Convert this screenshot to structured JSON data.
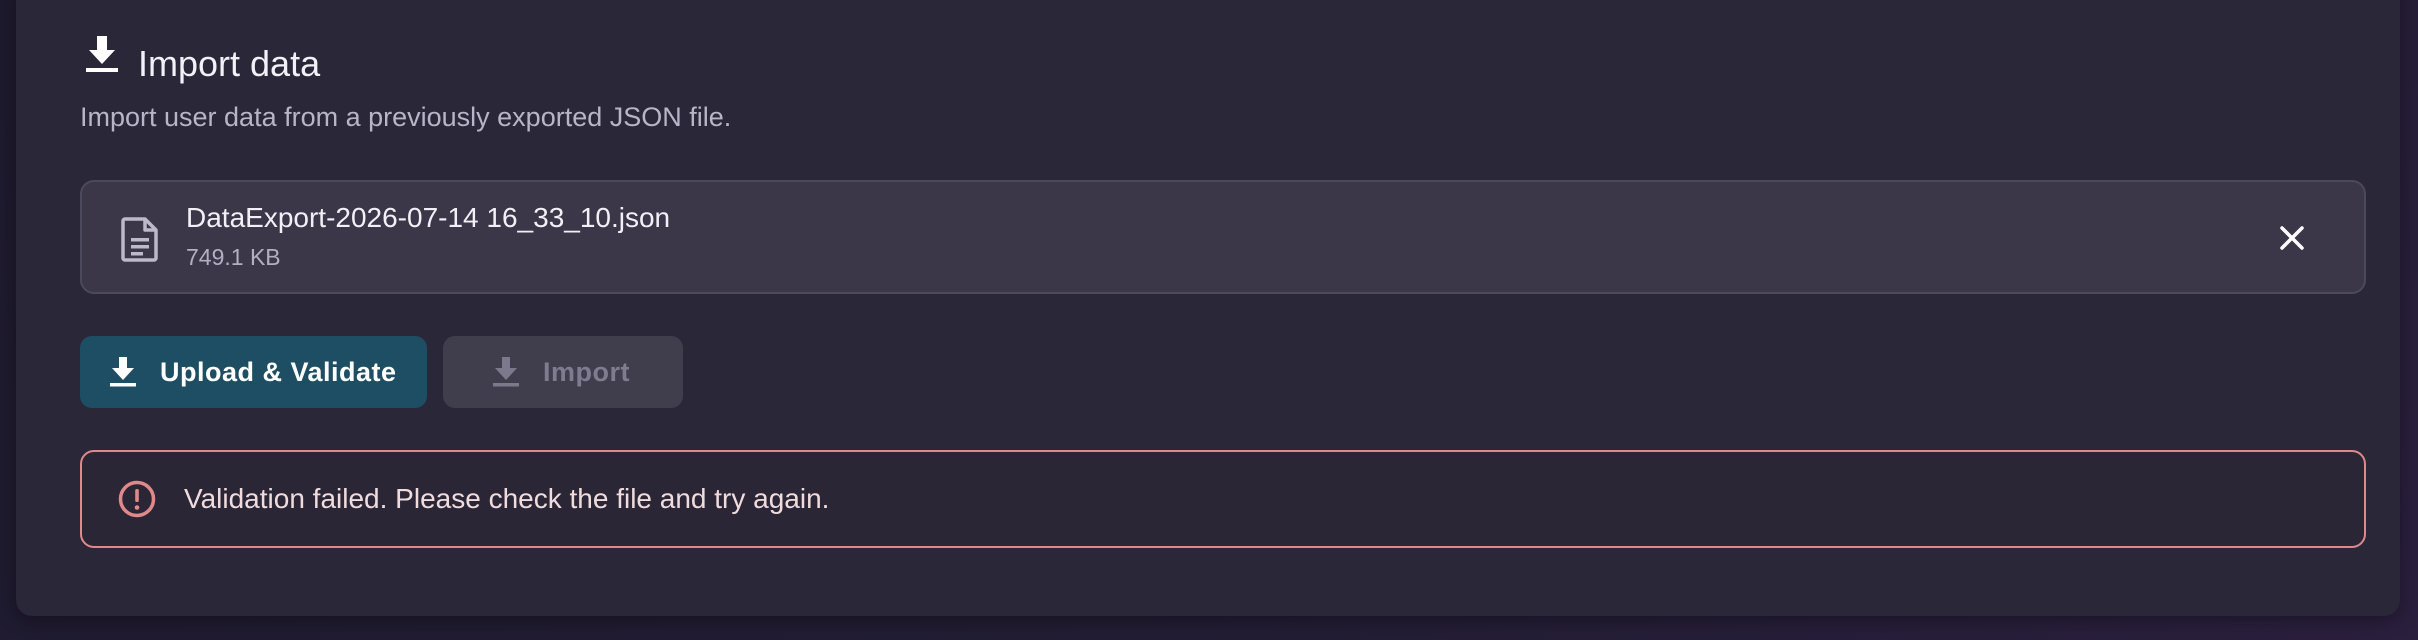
{
  "section": {
    "title": "Import data",
    "description": "Import user data from a previously exported JSON file.",
    "header_icon": "download-icon"
  },
  "file": {
    "name": "DataExport-2026-07-14 16_33_10.json",
    "size": "749.1 KB",
    "icon": "document-icon",
    "remove_icon": "close-icon"
  },
  "actions": {
    "upload_label": "Upload & Validate",
    "import_label": "Import",
    "import_disabled": true
  },
  "alert": {
    "message": "Validation failed. Please check the file and try again.",
    "icon": "error-icon",
    "color": "#e0898a"
  },
  "colors": {
    "card_bg": "#2a2738",
    "primary": "#1e4e63",
    "disabled": "#403d4d",
    "error": "#e0898a"
  }
}
